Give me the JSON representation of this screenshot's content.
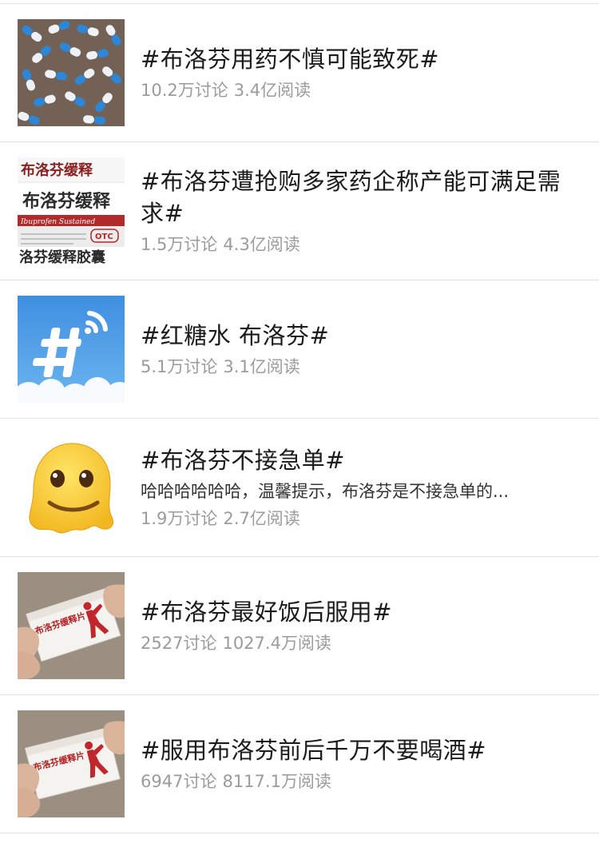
{
  "topics": [
    {
      "title": "#布洛芬用药不慎可能致死#",
      "desc": "",
      "discussions": "10.2万讨论",
      "reads": "3.4亿阅读",
      "thumb": "capsules-photo"
    },
    {
      "title": "#布洛芬遭抢购多家药企称产能可满足需求#",
      "desc": "",
      "discussions": "1.5万讨论",
      "reads": "4.3亿阅读",
      "thumb": "medicine-box-photo",
      "thumb_text": [
        "布洛芬缓释",
        "布洛芬缓释",
        "Ibuprofen Sustained",
        "OTC",
        "洛芬缓释胶囊"
      ]
    },
    {
      "title": "#红糖水 布洛芬#",
      "desc": "",
      "discussions": "5.1万讨论",
      "reads": "3.1亿阅读",
      "thumb": "hashtag-icon"
    },
    {
      "title": "#布洛芬不接急单#",
      "desc": "哈哈哈哈哈哈，温馨提示，布洛芬是不接急单的...",
      "discussions": "1.9万讨论",
      "reads": "2.7亿阅读",
      "thumb": "melting-face-emoji"
    },
    {
      "title": "#布洛芬最好饭后服用#",
      "desc": "",
      "discussions": "2527讨论",
      "reads": "1027.4万阅读",
      "thumb": "medicine-box-hand-photo",
      "thumb_text": [
        "布洛芬缓释片"
      ]
    },
    {
      "title": "#服用布洛芬前后千万不要喝酒#",
      "desc": "",
      "discussions": "6947讨论",
      "reads": "8117.1万阅读",
      "thumb": "medicine-box-hand-photo",
      "thumb_text": [
        "布洛芬缓释片"
      ]
    }
  ],
  "colors": {
    "title": "#1b1b1b",
    "desc": "#333333",
    "stats": "#9b9b9b",
    "divider": "#e3e3e3",
    "hashtag_bg": "#3d9be3"
  }
}
